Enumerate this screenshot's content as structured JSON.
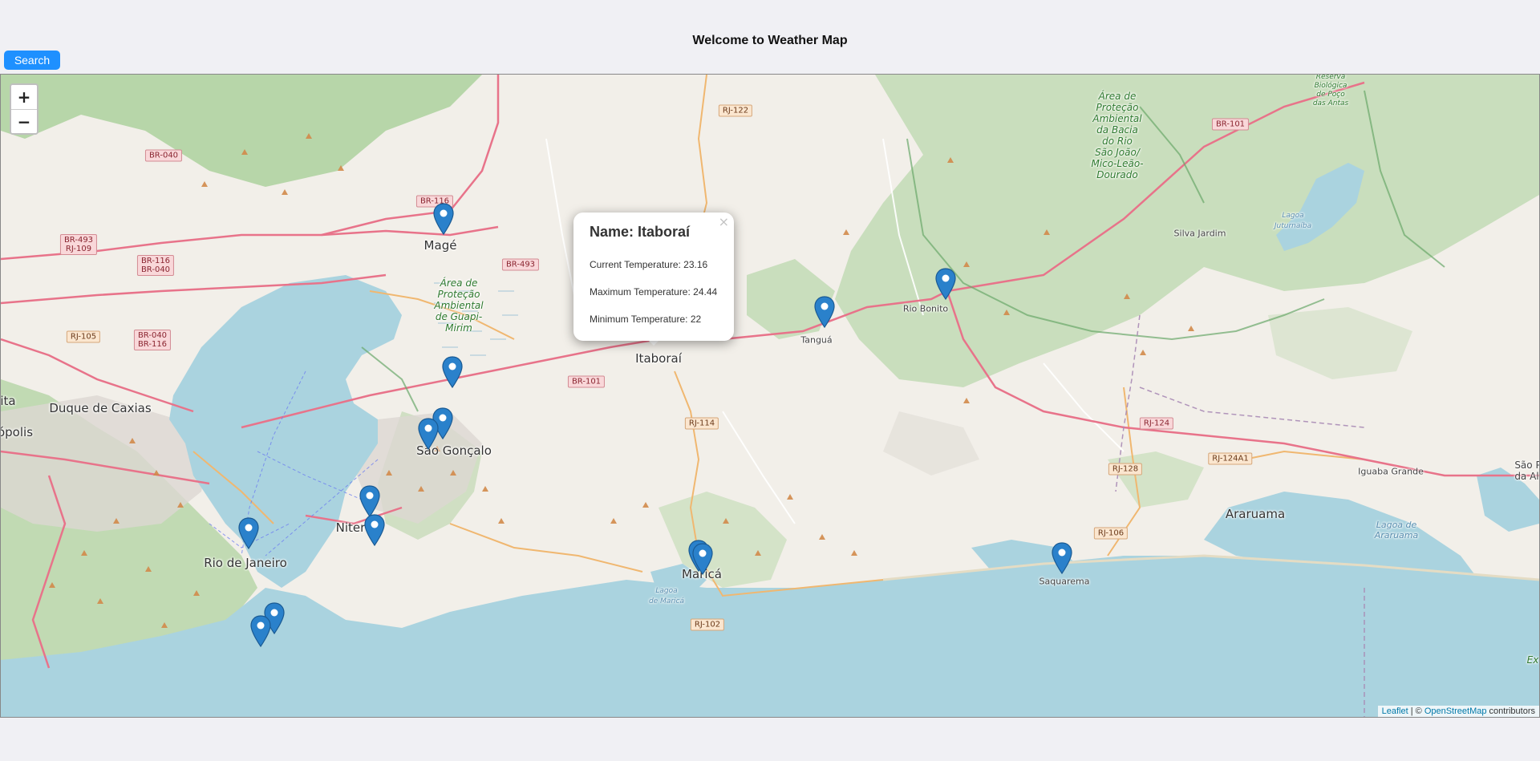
{
  "header": {
    "title": "Welcome to Weather Map",
    "search_label": "Search"
  },
  "map": {
    "zoom_in": "+",
    "zoom_out": "−",
    "cities": {
      "mage": "Magé",
      "itaborai": "Itaboraí",
      "tangua": "Tanguá",
      "rio_bonito": "Rio Bonito",
      "duque_de_caxias": "Duque de Caxias",
      "sao_goncalo": "São Gonçalo",
      "niteroi": "Niter",
      "rio_de_janeiro": "Rio de Janeiro",
      "marica": "Maricá",
      "saquarema": "Saquarema",
      "araruama": "Araruama",
      "silva_jardim": "Silva Jardim",
      "iguaba_grande": "Iguaba Grande",
      "polis": "ópolis",
      "ita": "ita",
      "sao_p": "São P\nda Al"
    },
    "areas": {
      "apa_bacia": "Área de\nProteção\nAmbiental\nda Bacia\ndo Rio\nSão João/\nMico-Leão-\nDourado",
      "apa_guapi": "Área de\nProteção\nAmbiental\nde Guapi-\nMirim",
      "reserva": "Reserva\nBiológica\nde Poço\ndas Antas",
      "lagoa_juturnaiba": "Lagoa\nJuturnaíba",
      "lagoa_araruama": "Lagoa de\nAraruama",
      "lagoa_marica": "Lagoa\nde Maricá",
      "ex": "Ex"
    },
    "shields": {
      "rj122": "RJ-122",
      "br101_ne": "BR-101",
      "br040": "BR-040",
      "br116_top": "BR-116",
      "br493_rj109": "BR-493\nRJ-109",
      "br116_br040": "BR-116\nBR-040",
      "br493": "BR-493",
      "rj105": "RJ-105",
      "br040_br116": "BR-040\nBR-116",
      "br101": "BR-101",
      "rj114": "RJ-114",
      "rj124": "RJ-124",
      "rj128": "RJ-128",
      "rj124a1": "RJ-124A1",
      "rj106": "RJ-106",
      "rj102": "RJ-102"
    },
    "popup": {
      "close": "×",
      "name_label": "Name: Itaboraí",
      "current": "Current Temperature: 23.16",
      "maximum": "Maximum Temperature: 24.44",
      "minimum": "Minimum Temperature: 22"
    },
    "attribution": {
      "leaflet": "Leaflet",
      "sep": " | © ",
      "osm": "OpenStreetMap",
      "contributors": " contributors"
    },
    "colors": {
      "water": "#aad3df",
      "land": "#f2efe9",
      "forest": "#add19e",
      "road_primary": "#e8738a",
      "road_secondary": "#f0b770",
      "marker": "#2a81cb"
    }
  }
}
